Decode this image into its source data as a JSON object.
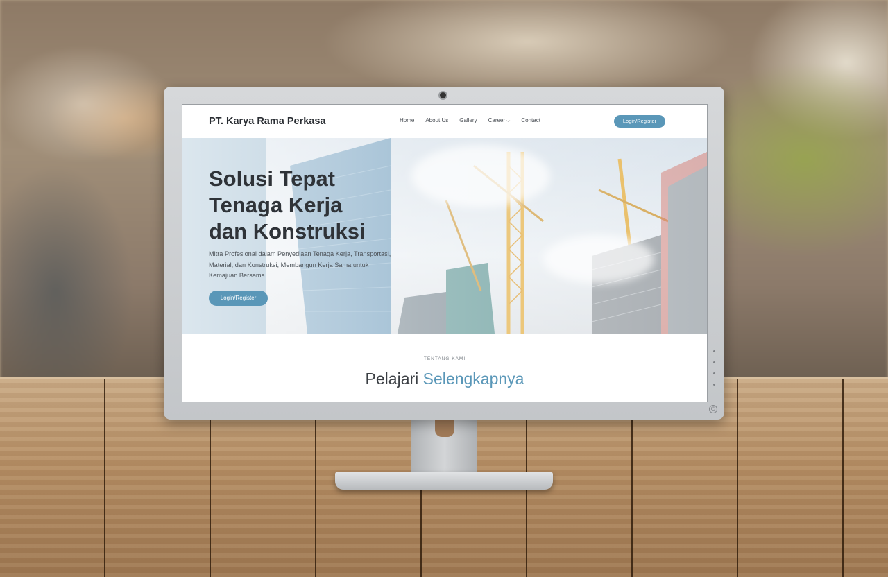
{
  "site": {
    "brand": "PT. Karya Rama Perkasa",
    "nav": {
      "items": [
        "Home",
        "About Us",
        "Gallery",
        "Career",
        "Contact"
      ],
      "login_register": "Login/Register"
    },
    "hero": {
      "title_line1": "Solusi Tepat",
      "title_line2": "Tenaga Kerja",
      "title_line3": "dan Konstruksi",
      "subtitle": "Mitra Profesional dalam Penyediaan Tenaga Kerja, Transportasi, Material, dan Konstruksi, Membangun Kerja Sama untuk Kemajuan Bersama",
      "cta": "Login/Register"
    },
    "about": {
      "eyebrow": "TENTANG KAMI",
      "heading_plain": "Pelajari",
      "heading_accent": "Selengkapnya"
    }
  },
  "icons": {
    "career_dropdown": "chevron-down-icon",
    "monitor_power": "power-icon",
    "monitor_camera": "webcam-icon"
  },
  "colors": {
    "accent": "#5a97b8",
    "text_dark": "#2f3338"
  }
}
